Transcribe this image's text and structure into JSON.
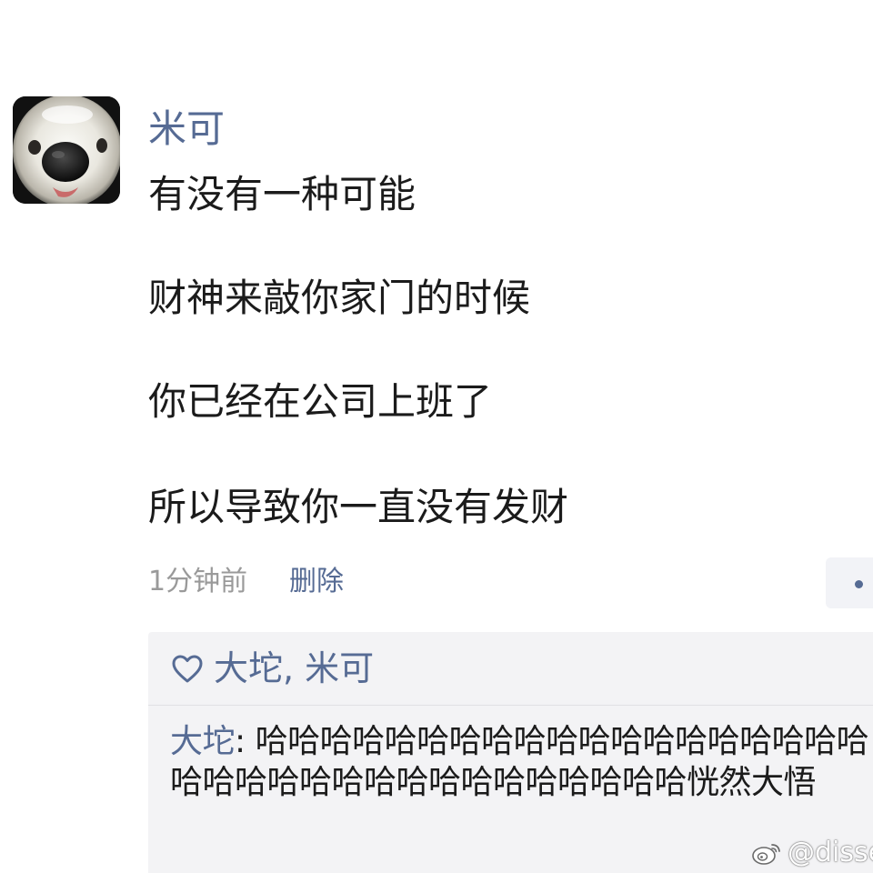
{
  "post": {
    "author": "米可",
    "avatar_icon": "dog-face-avatar",
    "lines": [
      "有没有一种可能",
      "财神来敲你家门的时候",
      "你已经在公司上班了",
      "所以导致你一直没有发财"
    ],
    "timestamp": "1分钟前",
    "delete_label": "删除",
    "more_icon": "more-dot-icon"
  },
  "likes": {
    "icon": "heart-icon",
    "names": "大坨, 米可"
  },
  "comments": [
    {
      "author": "大坨",
      "separator": ": ",
      "text": "哈哈哈哈哈哈哈哈哈哈哈哈哈哈哈哈哈哈哈哈哈哈哈哈哈哈哈哈哈哈哈哈哈哈哈恍然大悟"
    }
  ],
  "watermark": {
    "icon": "weibo-icon",
    "text": "@disse"
  },
  "colors": {
    "link": "#566b94",
    "text": "#1b1b1b",
    "meta": "#9a9a9a",
    "panel_bg": "#f3f3f5"
  }
}
